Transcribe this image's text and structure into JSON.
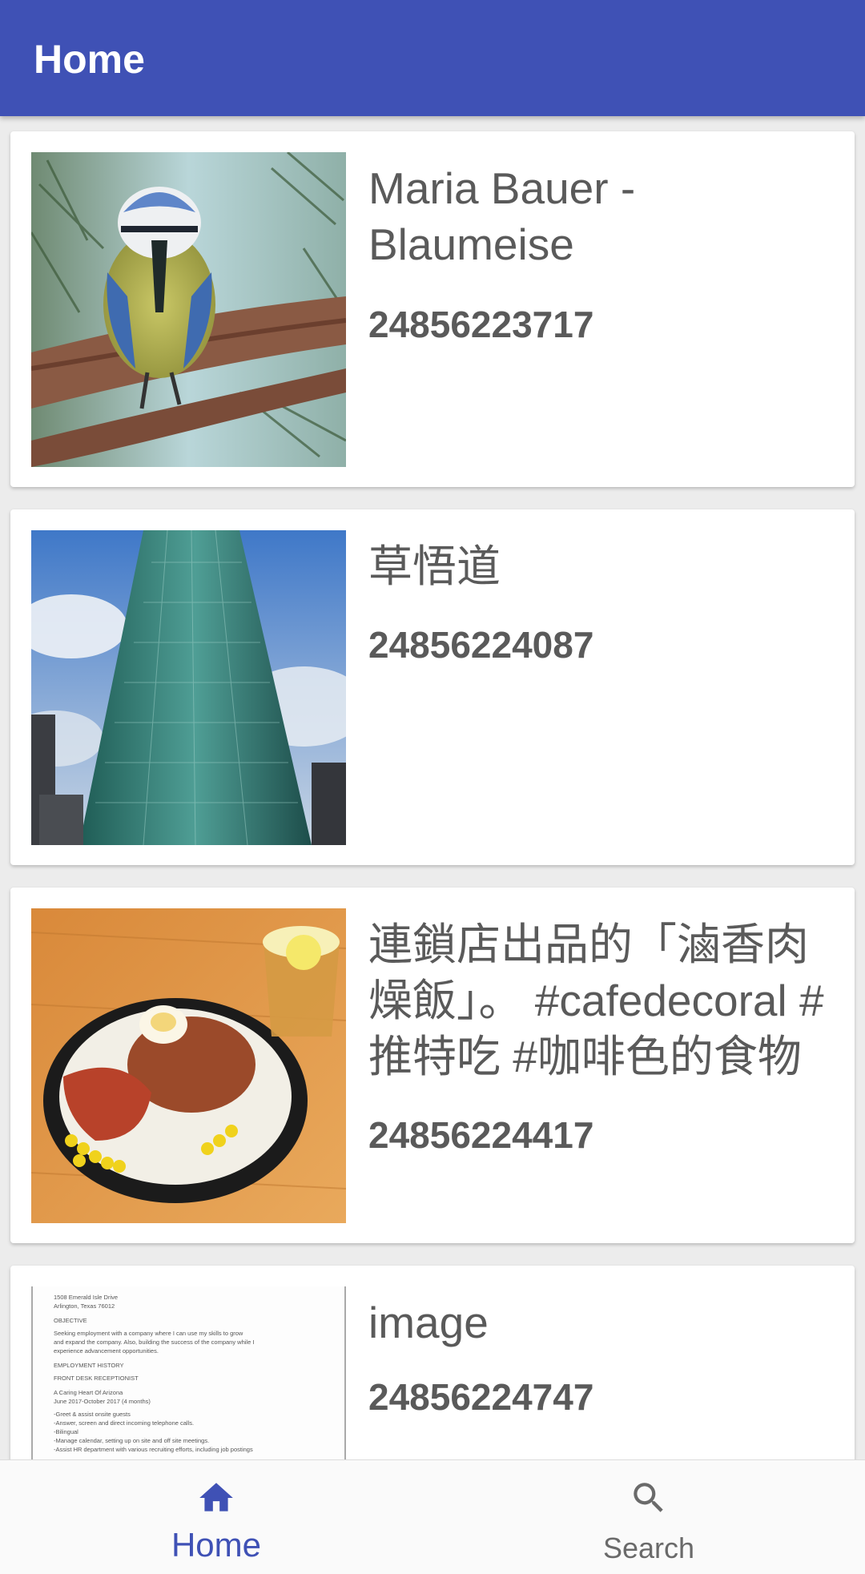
{
  "app_bar": {
    "title": "Home"
  },
  "feed": {
    "items": [
      {
        "title": "Maria Bauer - Blaumeise",
        "id": "24856223717",
        "image": "blue-tit-bird-photo"
      },
      {
        "title": "草悟道",
        "id": "24856224087",
        "image": "glass-skyscraper-photo"
      },
      {
        "title": "連鎖店出品的「滷香肉燥飯」。 #cafedecoral #推特吃 #咖啡色的食物",
        "id": "24856224417",
        "image": "rice-bowl-food-photo"
      },
      {
        "title": "image",
        "id": "24856224747",
        "image": "resume-document-photo"
      }
    ]
  },
  "doc_thumb": {
    "lines": [
      "1508 Emerald Isle Drive",
      "Arlington, Texas 76012",
      "OBJECTIVE",
      "Seeking employment with a company where I can use my skills to grow",
      "and expand the company. Also, building the success of the company while I",
      "experience advancement opportunities.",
      "EMPLOYMENT HISTORY",
      "FRONT DESK RECEPTIONIST",
      "A Caring Heart Of Arizona",
      "June 2017-October 2017 (4 months)",
      "-Greet & assist onsite guests",
      "-Answer, screen and direct incoming telephone calls.",
      "-Bilingual",
      "-Manage calendar, setting up on site and off site meetings.",
      "-Assist HR department with various recruiting efforts, including job postings"
    ]
  },
  "bottom_nav": {
    "home_label": "Home",
    "search_label": "Search",
    "active": "home"
  },
  "colors": {
    "primary": "#3f51b5",
    "text": "#5a5a5a",
    "inactive": "#6a6a6a"
  }
}
